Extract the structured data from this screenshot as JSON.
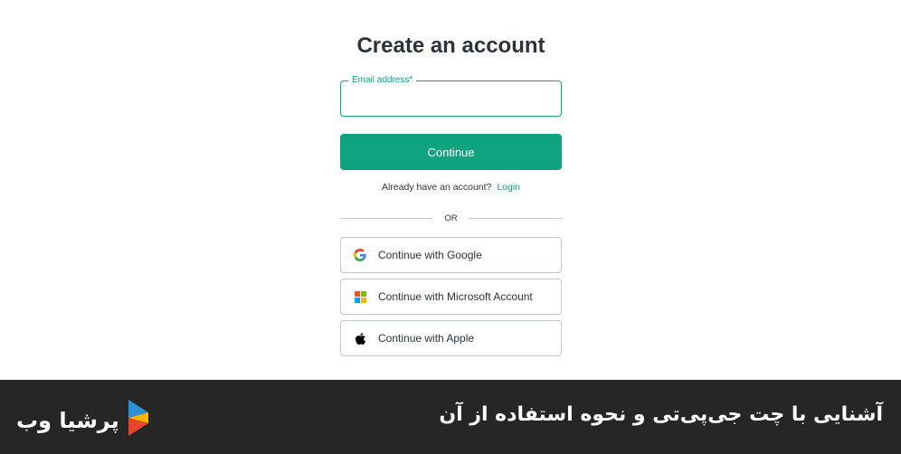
{
  "form": {
    "title": "Create an account",
    "email_label": "Email address*",
    "email_value": "",
    "continue_label": "Continue",
    "login_prompt": "Already have an account?",
    "login_link": "Login",
    "divider_text": "OR",
    "social_buttons": [
      {
        "label": "Continue with Google",
        "icon": "google-icon"
      },
      {
        "label": "Continue with Microsoft Account",
        "icon": "microsoft-icon"
      },
      {
        "label": "Continue with Apple",
        "icon": "apple-icon"
      }
    ]
  },
  "footer": {
    "title": "آشنایی با چت جی‌پی‌تی و نحوه استفاده از آن",
    "brand_name": "پرشیا وب",
    "brand_icon": "persiaweb-logo-icon"
  },
  "colors": {
    "accent": "#10a37f",
    "footer_bg": "#262626",
    "border": "#c2c8d0"
  }
}
